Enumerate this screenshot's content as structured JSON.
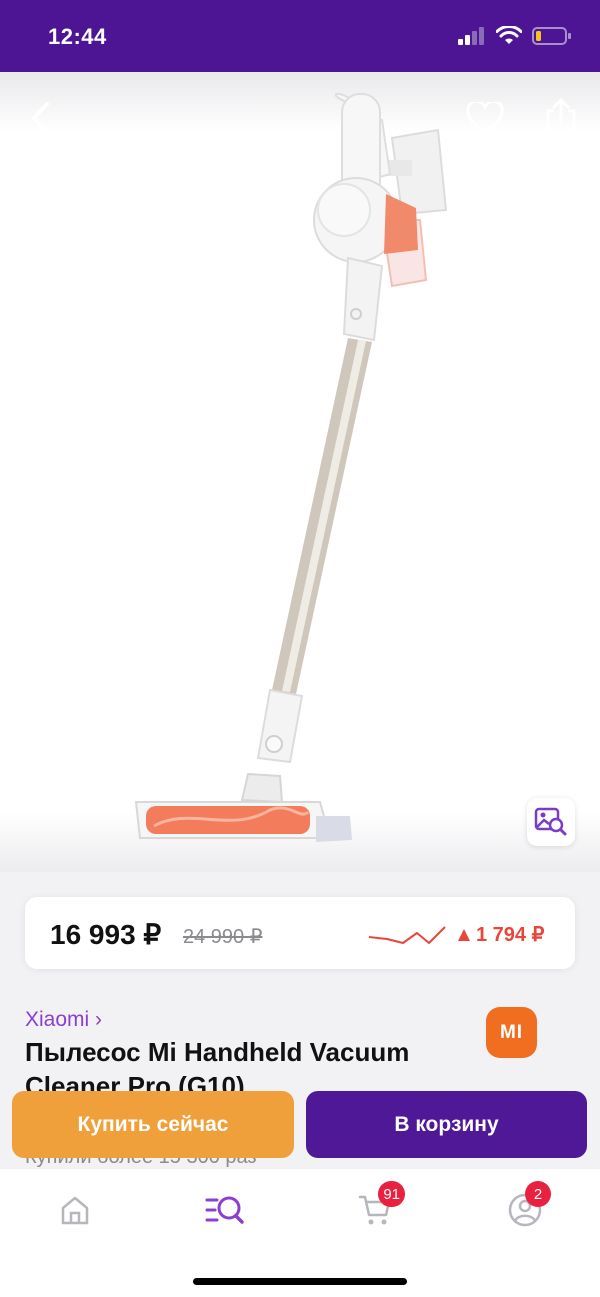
{
  "status_bar": {
    "time": "12:44"
  },
  "price": {
    "current": "16 993 ₽",
    "old": "24 990 ₽",
    "change": "1 794 ₽"
  },
  "product": {
    "brand": "Xiaomi ›",
    "brand_logo_text": "MI",
    "title": "Пылесос Mi Handheld Vacuum Cleaner Pro (G10)",
    "sold": "Купили более 15 300 раз",
    "partial_link": "в"
  },
  "actions": {
    "buy_now": "Купить сейчас",
    "add_to_cart": "В корзину"
  },
  "tabs": [
    {
      "name": "home",
      "icon": "home-icon"
    },
    {
      "name": "catalog",
      "icon": "catalog-search-icon"
    },
    {
      "name": "cart",
      "icon": "cart-icon",
      "badge": "91"
    },
    {
      "name": "profile",
      "icon": "profile-icon",
      "badge": "2"
    }
  ],
  "colors": {
    "header": "#4d1594",
    "accent": "#8b3fd0",
    "buy_now": "#f0a03a",
    "add_to_cart": "#4f1897",
    "price_up": "#e9463a",
    "badge": "#e9203f"
  }
}
